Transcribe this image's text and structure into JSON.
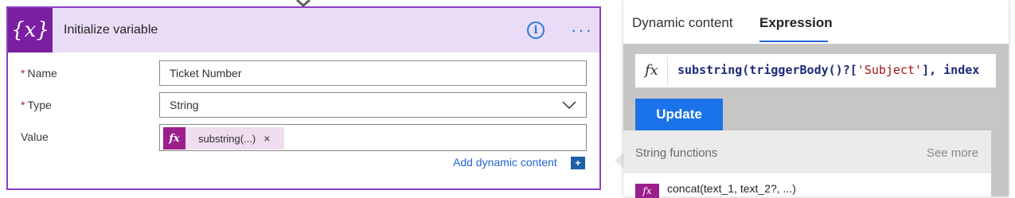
{
  "card": {
    "title": "Initialize variable",
    "icon": "variable-icon",
    "fields": {
      "name_label": "Name",
      "name_value": "Ticket Number",
      "type_label": "Type",
      "type_value": "String",
      "value_label": "Value",
      "value_token": "substring(...)",
      "required_mark": "*"
    },
    "add_dynamic_label": "Add dynamic content",
    "add_dynamic_icon": "+"
  },
  "panel": {
    "tabs": [
      "Dynamic content",
      "Expression"
    ],
    "active_tab": "Expression",
    "expression_prefix": "substring(triggerBody()?[",
    "expression_string": "'Subject'",
    "expression_suffix": "], index",
    "update_label": "Update",
    "section_label": "String functions",
    "see_more_label": "See more",
    "functions": [
      "concat(text_1, text_2?, ...)"
    ]
  },
  "colors": {
    "accent_purple": "#8c3dc4",
    "header_bg": "#eadcf6",
    "link_blue": "#2266d6",
    "update_blue": "#1a73e8",
    "fx_magenta": "#9c1f8c"
  }
}
